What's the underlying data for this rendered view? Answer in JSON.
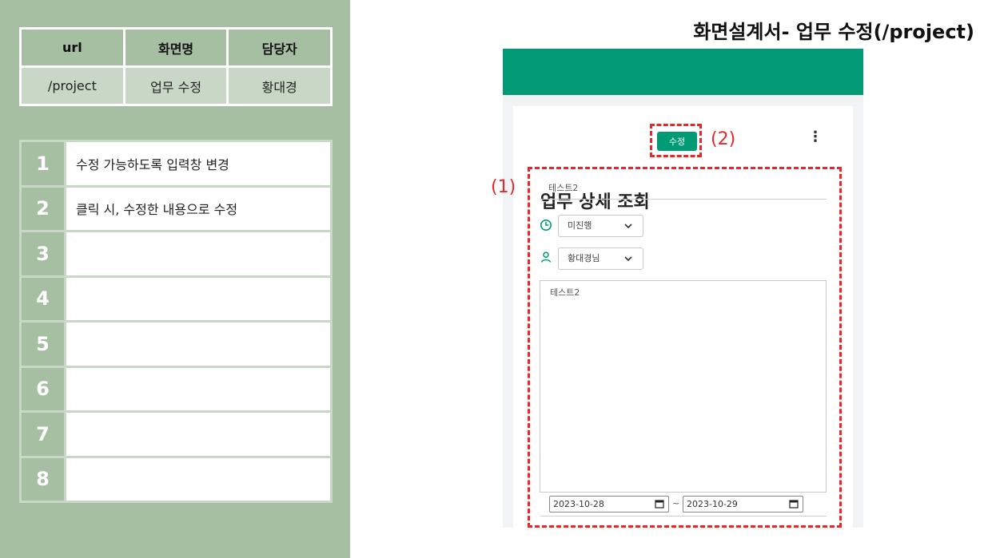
{
  "header": {
    "doc_title": "화면설계서- 업무 수정(/project)"
  },
  "info_table": {
    "headers": [
      "url",
      "화면명",
      "담당자"
    ],
    "values": [
      "/project",
      "업무 수정",
      "황대경"
    ]
  },
  "spec_items": [
    {
      "num": "1",
      "desc": "수정 가능하도록 입력창 변경"
    },
    {
      "num": "2",
      "desc": "클릭 시, 수정한 내용으로 수정"
    },
    {
      "num": "3",
      "desc": ""
    },
    {
      "num": "4",
      "desc": ""
    },
    {
      "num": "5",
      "desc": ""
    },
    {
      "num": "6",
      "desc": ""
    },
    {
      "num": "7",
      "desc": ""
    },
    {
      "num": "8",
      "desc": ""
    }
  ],
  "mockup": {
    "page_title": "업무 상세 조회",
    "edit_button": "수정",
    "menu_icon": "⋮",
    "title_value": "테스트2",
    "status_value": "미진행",
    "assignee_value": "황대경님",
    "content_value": "테스트2",
    "start_date": "2023-10-28",
    "end_date": "2023-10-29",
    "date_separator": "~"
  },
  "annotations": {
    "label_1": "(1)",
    "label_2": "(2)"
  },
  "colors": {
    "brand_green": "#009a74",
    "panel_green": "#a6bfa3",
    "annotation_red": "#e8262b"
  },
  "icons": {
    "status": "clock-icon",
    "assignee": "person-icon",
    "dropdown": "chevron-down-icon",
    "calendar": "calendar-icon",
    "menu": "kebab-menu-icon"
  }
}
